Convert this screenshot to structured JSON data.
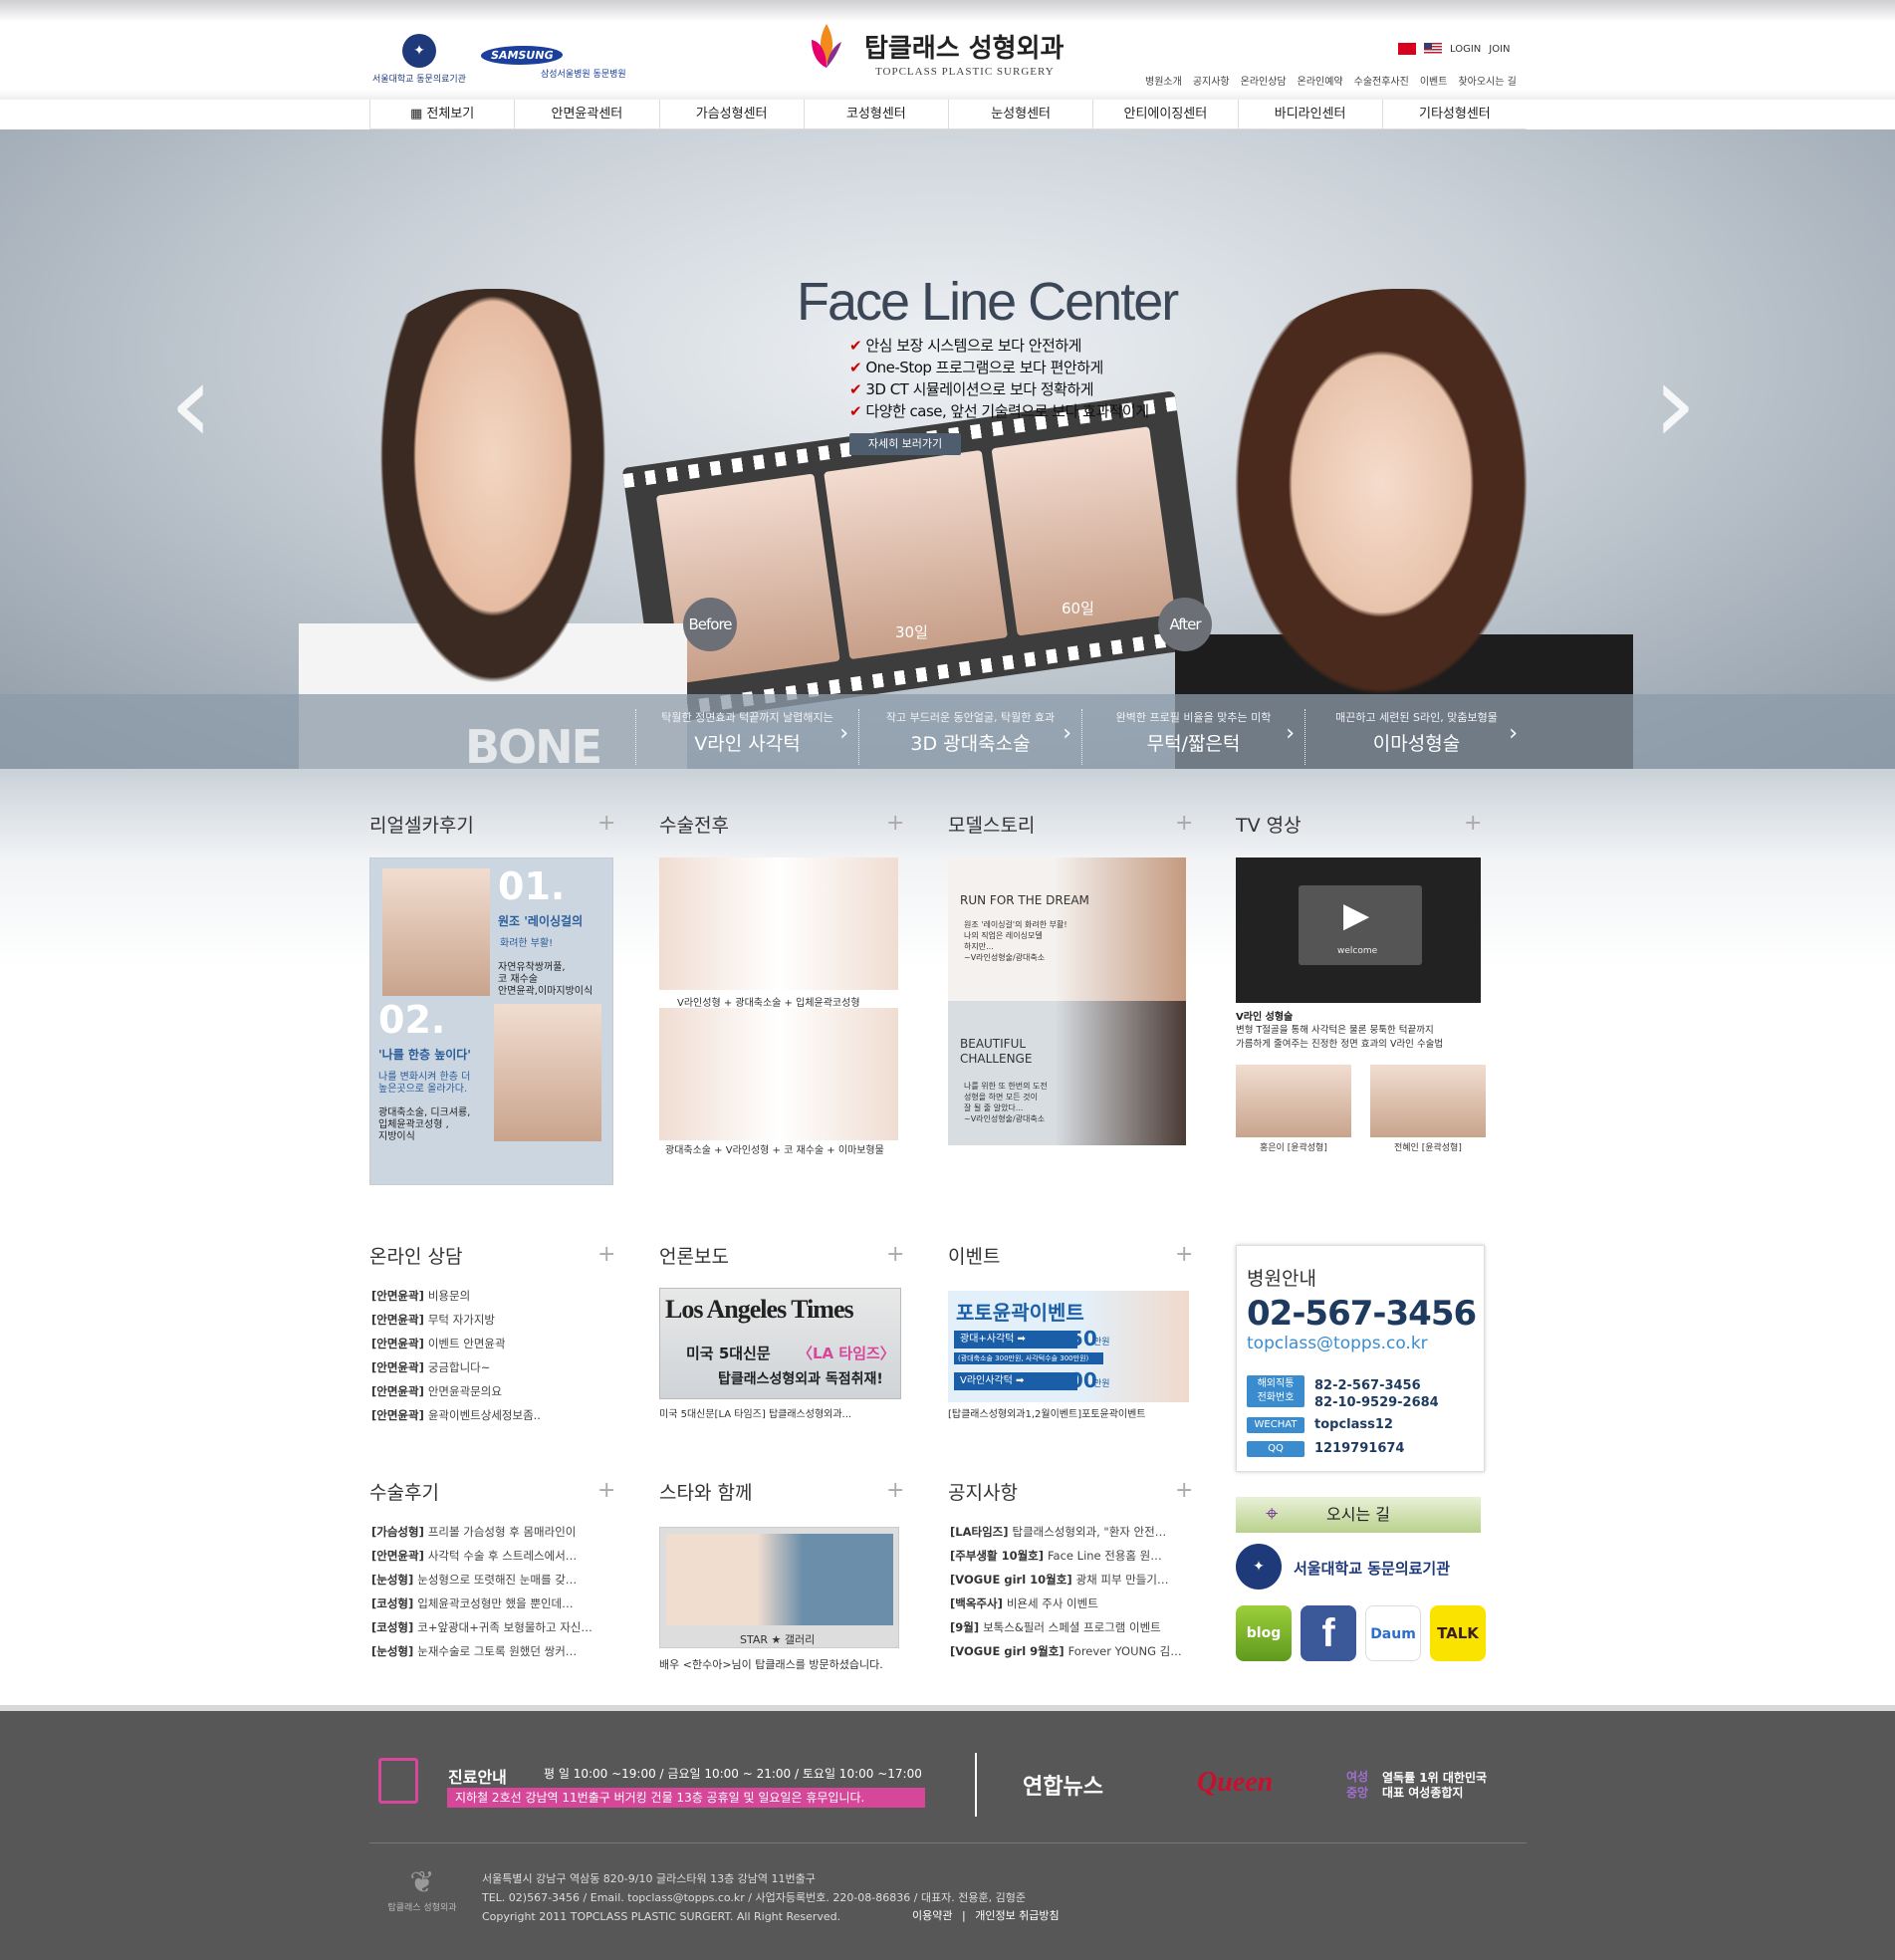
{
  "header": {
    "univ_logo_text": "서울대학교 동문의료기관",
    "samsung_logo": "SAMSUNG",
    "samsung_text": "삼성서울병원 동문병원",
    "brand_kr": "탑클래스 성형외과",
    "brand_en": "TOPCLASS PLASTIC SURGERY",
    "login": "LOGIN",
    "join": "JOIN",
    "util_nav": [
      "병원소개",
      "공지사항",
      "온라인상담",
      "온라인예약",
      "수술전후사진",
      "이벤트",
      "찾아오시는 길"
    ]
  },
  "gnb": [
    "▦ 전체보기",
    "안면윤곽센터",
    "가슴성형센터",
    "코성형센터",
    "눈성형센터",
    "안티에이징센터",
    "바디라인센터",
    "기타성형센터"
  ],
  "hero": {
    "title": "Face Line Center",
    "bullets": [
      "안심 보장 시스템으로 보다 안전하게",
      "One-Stop 프로그램으로 보다 편안하게",
      "3D CT 시뮬레이션으로 보다 정확하게",
      "다양한 case, 앞선 기술력으로 보다 효과적이게"
    ],
    "detail_button": "자세히 보러가기",
    "before": "Before",
    "after": "After",
    "day30": "30일",
    "day60": "60일",
    "prev": "‹",
    "next": "›",
    "bone": "BONE",
    "categories": [
      {
        "sub": "탁월한 정면효과 턱끝까지 날렵해지는",
        "main": "V라인 사각턱"
      },
      {
        "sub": "작고 부드러운 동안얼굴, 탁월한 효과",
        "main": "3D 광대축소술"
      },
      {
        "sub": "완벽한 프로필 비율을 맞추는 미학",
        "main": "무턱/짧은턱"
      },
      {
        "sub": "매끈하고 세련된 S라인, 맞춤보형물",
        "main": "이마성형술"
      }
    ]
  },
  "row1": {
    "realself": {
      "title": "리얼셀카후기",
      "n1": "01.",
      "h1": "원조 '레이싱걸의",
      "h1b": "화려한 부활!",
      "d1": "자연유착쌍꺼풀,\n코 재수술\n안면윤곽,이마지방이식",
      "n2": "02.",
      "h2": "'나를 한층 높이다'",
      "h2b": "나를 변화시켜 한층 더\n높은곳으로 올라가다.",
      "d2": "광대축소술, 디크셔룡,\n입체윤곽코성형 ,\n지방이식"
    },
    "beforeafter": {
      "title": "수술전후",
      "cap1": "V라인성형 + 광대축소술 + 입체윤곽코성형",
      "cap2": "광대축소술 + V라인성형 + 코 재수술 + 이마보형물"
    },
    "model": {
      "title": "모델스토리",
      "card1_title": "RUN FOR THE DREAM",
      "card1_text": "원조 '레이싱걸'의 화려한 부활!\n나의 직업은 레이싱모델\n하지만...\n~V라인성형술/광대축소",
      "card2_title": "BEAUTIFUL\nCHALLENGE",
      "card2_text": "나를 위한 또 한번의 도전\n성형을 하면 모든 것이\n잘 될 줄 알았다...\n~V라인성형술/광대축소"
    },
    "tv": {
      "title": "TV 영상",
      "video_label": "welcome",
      "vtitle": "V라인 성형술",
      "vdesc1": "변형 T절골을 통해 사각턱은 물론 뭉툭한 턱끝까지",
      "vdesc2": "가름하게 줄여주는 진정한 정면 효과의 V라인 수술법",
      "thumb1": "홍은이 [윤곽성형]",
      "thumb2": "전혜인 [윤곽성형]"
    }
  },
  "row2": {
    "consult": {
      "title": "온라인 상담",
      "items": [
        {
          "tag": "[안면윤곽]",
          "text": "비용문의"
        },
        {
          "tag": "[안면윤곽]",
          "text": "무턱 자가지방"
        },
        {
          "tag": "[안면윤곽]",
          "text": "이벤트 안면윤곽"
        },
        {
          "tag": "[안면윤곽]",
          "text": "궁금합니다~"
        },
        {
          "tag": "[안면윤곽]",
          "text": "안면윤곽문의요"
        },
        {
          "tag": "[안면윤곽]",
          "text": "윤곽이벤트상세정보좀.."
        }
      ]
    },
    "press": {
      "title": "언론보도",
      "paper": "Los Angeles Times",
      "line1": "미국 5대신문",
      "line1b": "〈LA 타임즈〉",
      "line2": "탑클래스성형외과 독점취재!",
      "caption": "미국 5대신문[LA 타임즈] 탑클래스성형외과..."
    },
    "event": {
      "title": "이벤트",
      "banner": "포토윤곽이벤트",
      "l1": "광대+사각턱 ➡",
      "p1": "550",
      "unit": "만원",
      "l1s": "(광대축소술 300만원, 사각턱수술 300만원)",
      "l2": "V라인사각턱 ➡",
      "p2": "500",
      "caption": "[탑클래스성형외과1,2월이벤트]포토윤곽이벤트"
    },
    "info": {
      "title": "병원안내",
      "tel": "02-567-3456",
      "email": "topclass@topps.co.kr",
      "intl_label": "해외직통\n전화번호",
      "intl1": "82-2-567-3456",
      "intl2": "82-10-9529-2684",
      "wechat_label": "WECHAT",
      "wechat": "topclass12",
      "qq_label": "QQ",
      "qq": "1219791674"
    }
  },
  "row3": {
    "review": {
      "title": "수술후기",
      "items": [
        {
          "tag": "[가슴성형]",
          "text": "프리볼 가슴성형 후 몸매라인이"
        },
        {
          "tag": "[안면윤곽]",
          "text": "사각턱 수술 후 스트레스에서…"
        },
        {
          "tag": "[눈성형]",
          "text": "눈성형으로 또렷해진 눈매를 갖…"
        },
        {
          "tag": "[코성형]",
          "text": "입체윤곽코성형만 했을 뿐인데…"
        },
        {
          "tag": "[코성형]",
          "text": "코+앞광대+귀족 보형물하고 자신…"
        },
        {
          "tag": "[눈성형]",
          "text": "눈재수술로 그토록 원했던 쌍커…"
        }
      ]
    },
    "star": {
      "title": "스타와 함께",
      "gallery": "STAR ★ 갤러리",
      "caption": "배우 <한수아>님이 탑클래스를 방문하셨습니다."
    },
    "notice": {
      "title": "공지사항",
      "items": [
        {
          "tag": "[LA타임즈]",
          "text": "탑클래스성형외과, \"환자 안전…"
        },
        {
          "tag": "[주부생활 10월호]",
          "text": "Face Line 전용홈 원…"
        },
        {
          "tag": "[VOGUE girl 10월호]",
          "text": "광채 피부 만들기…"
        },
        {
          "tag": "[백옥주사]",
          "text": "비욘세 주사 이벤트"
        },
        {
          "tag": "[9월]",
          "text": "보톡스&필러 스페셜 프로그램 이벤트"
        },
        {
          "tag": "[VOGUE girl 9월호]",
          "text": "Forever YOUNG 김…"
        }
      ]
    },
    "directions": "오시는 길",
    "snu": "서울대학교 동문의료기관",
    "sns": [
      "blog",
      "f",
      "Daum",
      "TALK"
    ]
  },
  "footer": {
    "hours_title": "진료안내",
    "hours": "평 일 10:00 ~19:00 / 금요일 10:00 ~ 21:00 / 토요일 10:00 ~17:00",
    "location": "지하철 2호선 강남역 11번출구 버거킹 건물 13층      공휴일 및 일요일은 휴무입니다.",
    "press1": "연합뉴스",
    "press2": "Queen",
    "press3": "열독률 1위 대한민국\n대표 여성종합지",
    "press3_logo": "여성중앙",
    "logo": "탑클래스 성형외과",
    "address": "서울특별시 강남구 역삼동 820-9/10 글라스타워 13층 강남역 11번출구",
    "contact": "TEL. 02)567-3456 / Email. topclass@topps.co.kr / 사업자등록번호. 220-08-86836 / 대표자. 전용훈, 김형준",
    "copyright": "Copyright  2011  TOPCLASS PLASTIC SURGERT. All Right Reserved.",
    "terms": "이용약관",
    "privacy": "개인정보 취급방침"
  }
}
